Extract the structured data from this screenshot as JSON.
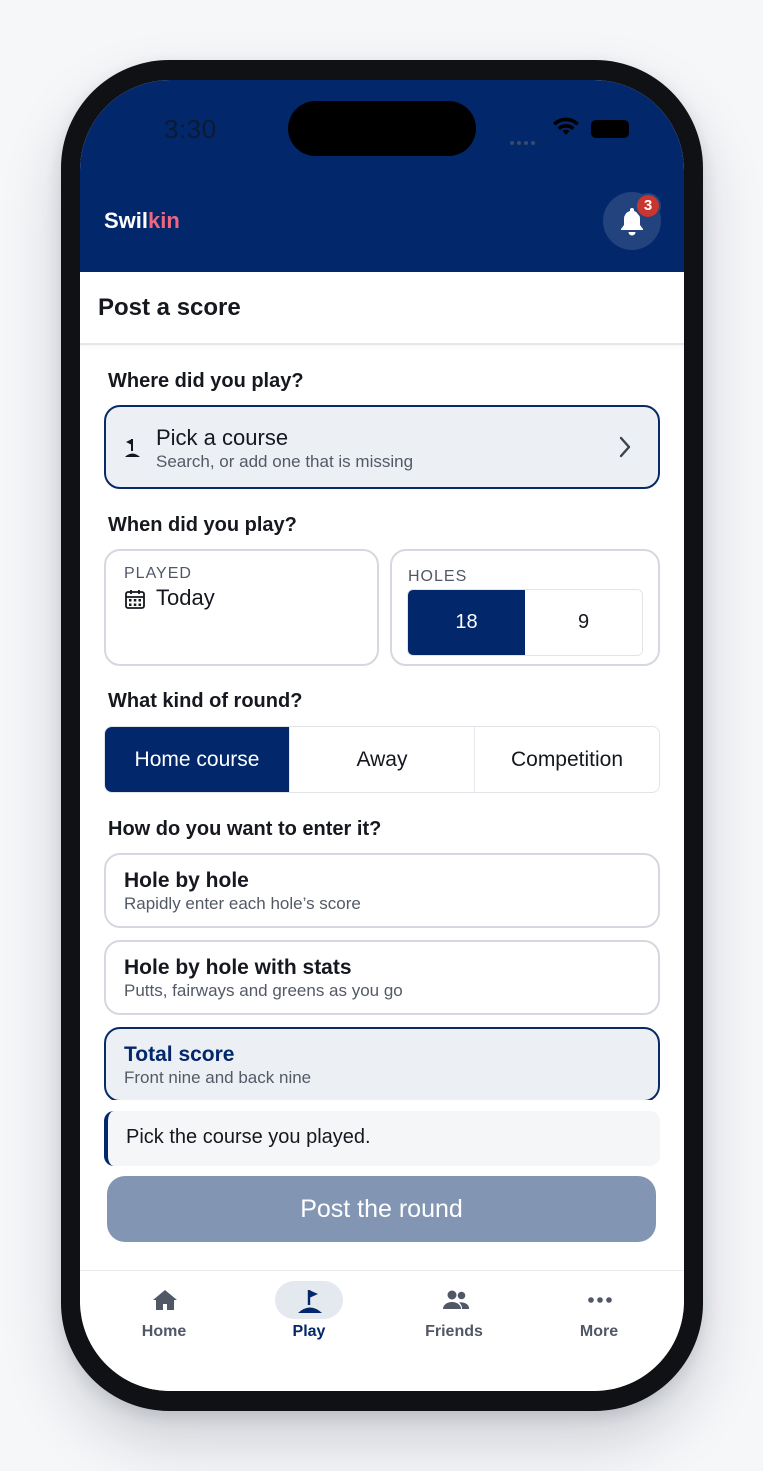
{
  "status_bar": {
    "time": "3:30"
  },
  "app": {
    "brand_prefix": "Swil",
    "brand_suffix": "kin",
    "notifications_count": "3"
  },
  "page": {
    "title": "Post a score"
  },
  "where": {
    "question": "Where did you play?",
    "title": "Pick a course",
    "subtitle": "Search, or add one that is missing",
    "icon": "flag-icon"
  },
  "when": {
    "question": "When did you play?",
    "played_label": "PLAYED",
    "played_value": "Today",
    "holes_label": "HOLES",
    "holes_options": [
      "18",
      "9"
    ],
    "holes_selected": "18"
  },
  "round_kind": {
    "question": "What kind of round?",
    "options": [
      "Home course",
      "Away",
      "Competition"
    ],
    "selected": "Home course"
  },
  "entry": {
    "question": "How do you want to enter it?",
    "options": [
      {
        "title": "Hole by hole",
        "subtitle": "Rapidly enter each hole’s score"
      },
      {
        "title": "Hole by hole with stats",
        "subtitle": "Putts, fairways and greens as you go"
      },
      {
        "title": "Total score",
        "subtitle": "Front nine and back nine"
      }
    ],
    "selected": "Total score"
  },
  "hint": "Pick the course you played.",
  "submit_label": "Post the round",
  "tabs": [
    {
      "label": "Home",
      "icon": "home-icon"
    },
    {
      "label": "Play",
      "icon": "flag-icon"
    },
    {
      "label": "Friends",
      "icon": "friends-icon"
    },
    {
      "label": "More",
      "icon": "more-icon"
    }
  ],
  "active_tab": "Play",
  "colors": {
    "primary": "#02276b",
    "accent": "#f0667f",
    "badge": "#c8362f",
    "disabled_button": "#8296b3"
  }
}
